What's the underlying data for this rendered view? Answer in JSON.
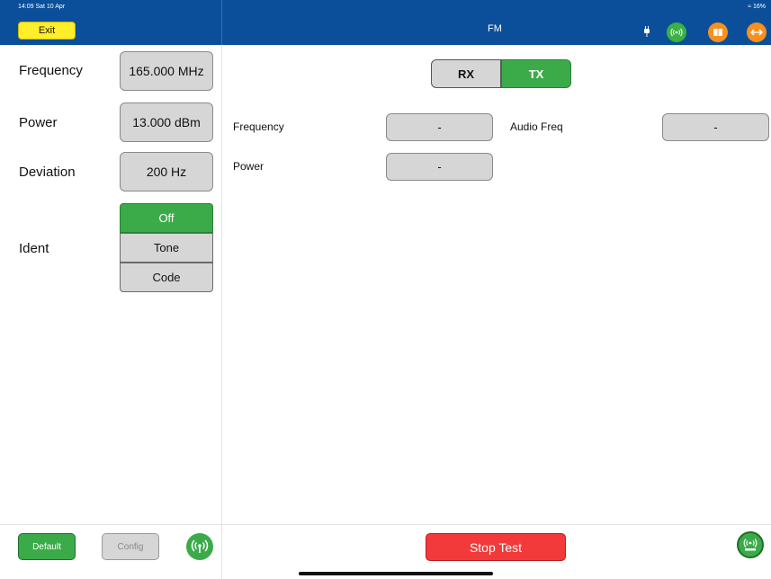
{
  "status_bar": {
    "time": "14:09  Sat 10 Apr",
    "battery": "16%"
  },
  "header": {
    "exit_label": "Exit",
    "title": "FM",
    "icons": [
      "plug-icon",
      "wireless-icon",
      "book-icon",
      "arrows-icon"
    ]
  },
  "left": {
    "frequency": {
      "label": "Frequency",
      "value": "165.000 MHz"
    },
    "power": {
      "label": "Power",
      "value": "13.000 dBm"
    },
    "deviation": {
      "label": "Deviation",
      "value": "200 Hz"
    },
    "ident": {
      "label": "Ident",
      "options": [
        "Off",
        "Tone",
        "Code"
      ],
      "selected": "Off"
    }
  },
  "mode_toggle": {
    "options": [
      "RX",
      "TX"
    ],
    "selected": "TX"
  },
  "measurements": {
    "frequency": {
      "label": "Frequency",
      "value": "-"
    },
    "power": {
      "label": "Power",
      "value": "-"
    },
    "audio_freq": {
      "label": "Audio Freq",
      "value": "-"
    }
  },
  "footer": {
    "default_label": "Default",
    "config_label": "Config",
    "stop_label": "Stop Test"
  },
  "colors": {
    "header": "#0b4f9b",
    "exit": "#ffee2a",
    "green": "#3bab4a",
    "orange": "#f7901e",
    "stop": "#f23a3a",
    "box": "#d6d6d6"
  }
}
